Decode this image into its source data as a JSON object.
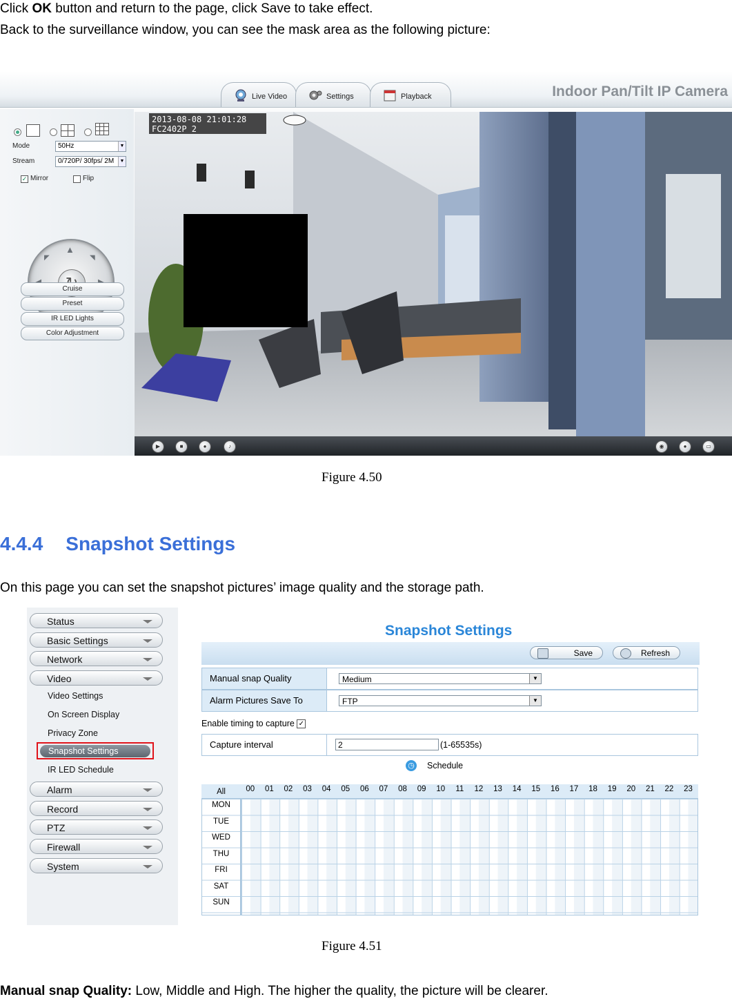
{
  "text": {
    "line1_pre": "Click ",
    "line1_bold": "OK",
    "line1_post": " button and return to the page, click Save to take effect.",
    "line2": "Back to the surveillance window, you can see the mask area as the following picture:",
    "caption1": "Figure 4.50",
    "heading_num": "4.4.4",
    "heading_title": "Snapshot Settings",
    "intro": "On this page you can set the snapshot pictures’ image quality and the storage path.",
    "caption2": "Figure 4.51",
    "final_bold": "Manual snap Quality:",
    "final_rest": " Low, Middle and High. The higher the quality, the picture will be clearer."
  },
  "fig1": {
    "tabs": [
      "Live Video",
      "Settings",
      "Playback"
    ],
    "brand": "Indoor Pan/Tilt IP Camera",
    "mode_label": "Mode",
    "mode_value": "50Hz",
    "stream_label": "Stream",
    "stream_value": "0/720P/ 30fps/ 2M",
    "mirror_label": "Mirror",
    "flip_label": "Flip",
    "buttons": [
      "Cruise",
      "Preset",
      "IR LED Lights",
      "Color Adjustment"
    ],
    "osd_line1": "2013-08-08 21:01:28",
    "osd_line2": "FC2402P 2",
    "mirror_checked": true,
    "flip_checked": false
  },
  "fig2": {
    "menu": [
      "Status",
      "Basic Settings",
      "Network",
      "Video",
      "Alarm",
      "Record",
      "PTZ",
      "Firewall",
      "System"
    ],
    "video_sub": [
      "Video Settings",
      "On Screen Display",
      "Privacy Zone",
      "Snapshot Settings",
      "IR LED Schedule"
    ],
    "title": "Snapshot Settings",
    "save": "Save",
    "refresh": "Refresh",
    "quality_label": "Manual snap Quality",
    "quality_value": "Medium",
    "save_to_label": "Alarm Pictures Save To",
    "save_to_value": "FTP",
    "enable_timing": "Enable timing to capture",
    "interval_label": "Capture interval",
    "interval_value": "2",
    "interval_range": "(1-65535s)",
    "schedule": "Schedule",
    "all": "All",
    "hours": [
      "00",
      "01",
      "02",
      "03",
      "04",
      "05",
      "06",
      "07",
      "08",
      "09",
      "10",
      "11",
      "12",
      "13",
      "14",
      "15",
      "16",
      "17",
      "18",
      "19",
      "20",
      "21",
      "22",
      "23"
    ],
    "days": [
      "MON",
      "TUE",
      "WED",
      "THU",
      "FRI",
      "SAT",
      "SUN"
    ]
  }
}
